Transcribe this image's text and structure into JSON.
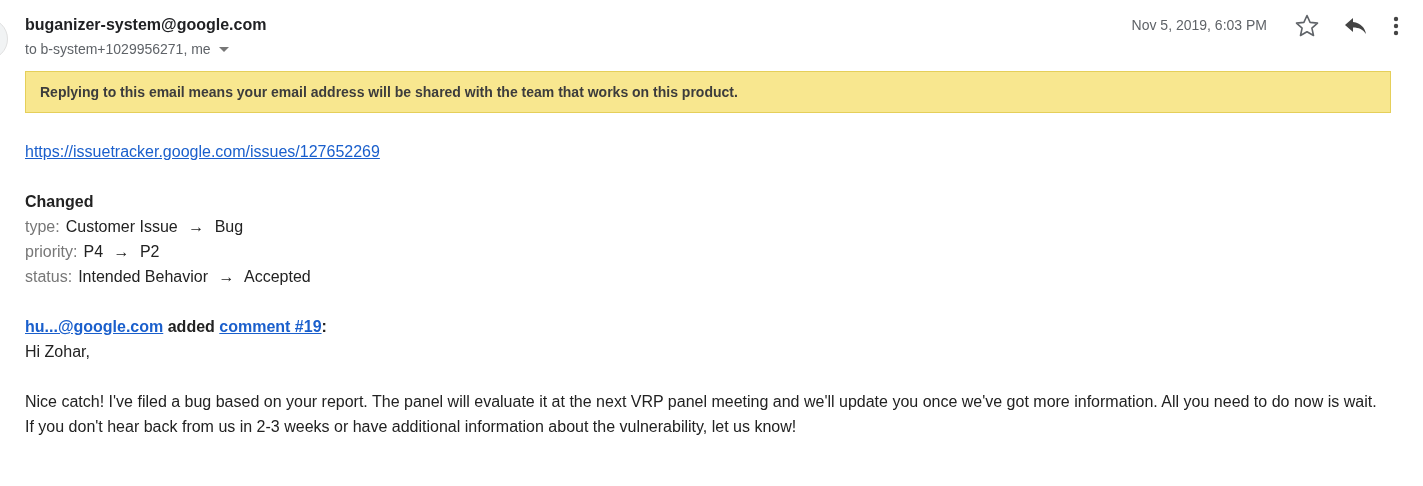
{
  "header": {
    "sender": "buganizer-system@google.com",
    "recipients": "to b-system+1029956271, me",
    "date": "Nov 5, 2019, 6:03 PM",
    "starred": false
  },
  "banner": {
    "text": "Replying to this email means your email address will be shared with the team that works on this product."
  },
  "body": {
    "issue_link": "https://issuetracker.google.com/issues/127652269",
    "changes_heading": "Changed",
    "changes": [
      {
        "label": "type:",
        "from": "Customer Issue",
        "arrow": "→",
        "to": "Bug"
      },
      {
        "label": "priority:",
        "from": "P4",
        "arrow": "→",
        "to": "P2"
      },
      {
        "label": "status:",
        "from": "Intended Behavior",
        "arrow": "→",
        "to": "Accepted"
      }
    ],
    "comment_line": {
      "author": "hu...@google.com",
      "verb": "added",
      "comment_link": "comment #19",
      "suffix": ":"
    },
    "greeting": "Hi Zohar,",
    "message": "Nice catch! I've filed a bug based on your report. The panel will evaluate it at the next VRP panel meeting and we'll update you once we've got more information. All you need to do now is wait. If you don't hear back from us in 2-3 weeks or have additional information about the vulnerability, let us know!"
  }
}
